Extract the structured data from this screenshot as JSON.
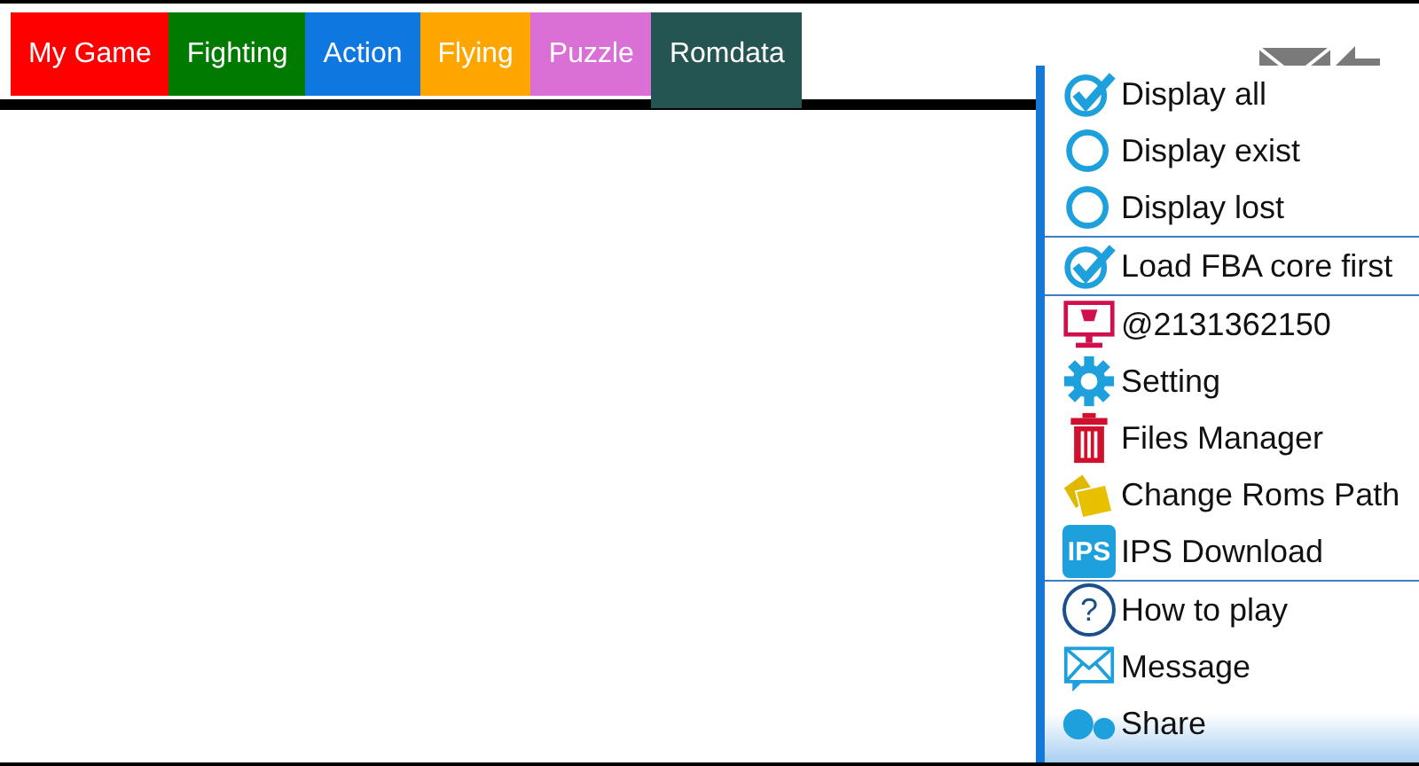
{
  "tabs": [
    {
      "label": "My Game",
      "color": "#ff0000",
      "selected": false
    },
    {
      "label": "Fighting",
      "color": "#007a00",
      "selected": false
    },
    {
      "label": "Action",
      "color": "#0f78e0",
      "selected": false
    },
    {
      "label": "Flying",
      "color": "#ffa500",
      "selected": false
    },
    {
      "label": "Puzzle",
      "color": "#da70d6",
      "selected": false
    },
    {
      "label": "Romdata",
      "color": "#245552",
      "selected": true
    }
  ],
  "menu": {
    "groups": [
      [
        {
          "kind": "check",
          "label": "Display all",
          "checked": true
        },
        {
          "kind": "check",
          "label": "Display exist",
          "checked": false
        },
        {
          "kind": "check",
          "label": "Display lost",
          "checked": false
        }
      ],
      [
        {
          "kind": "check",
          "label": "Load FBA core first",
          "checked": true
        }
      ],
      [
        {
          "kind": "monitor",
          "label": "@2131362150"
        },
        {
          "kind": "gear",
          "label": "Setting"
        },
        {
          "kind": "trash",
          "label": "Files Manager"
        },
        {
          "kind": "folders",
          "label": "Change Roms Path"
        },
        {
          "kind": "ips",
          "label": "IPS Download",
          "icon_text": "IPS"
        }
      ],
      [
        {
          "kind": "help",
          "label": "How to play",
          "icon_text": "?"
        },
        {
          "kind": "mail",
          "label": "Message"
        },
        {
          "kind": "share",
          "label": "Share"
        }
      ]
    ]
  }
}
